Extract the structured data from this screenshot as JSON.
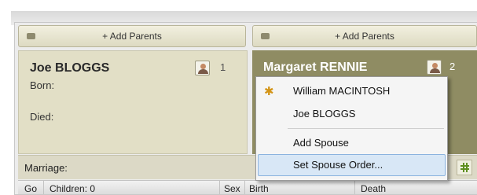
{
  "parents": {
    "left_button": "+ Add Parents",
    "right_button": "+ Add Parents"
  },
  "left_card": {
    "name": "Joe BLOGGS",
    "index": "1",
    "born_label": "Born:",
    "died_label": "Died:"
  },
  "right_card": {
    "name": "Margaret RENNIE",
    "index": "2"
  },
  "marriage": {
    "label": "Marriage:"
  },
  "children_header": {
    "col_go": "Go",
    "col_children": "Children: 0",
    "col_sex": "Sex",
    "col_birth": "Birth",
    "col_death": "Death"
  },
  "context_menu": {
    "items": [
      {
        "label": "William MACINTOSH"
      },
      {
        "label": "Joe BLOGGS"
      },
      {
        "label": "Add Spouse"
      },
      {
        "label": "Set Spouse Order..."
      }
    ]
  },
  "colors": {
    "selected_card": "#8f8c63",
    "card": "#e2dfc6",
    "menu_highlight": "#d8e7f6",
    "star": "#d39416"
  }
}
